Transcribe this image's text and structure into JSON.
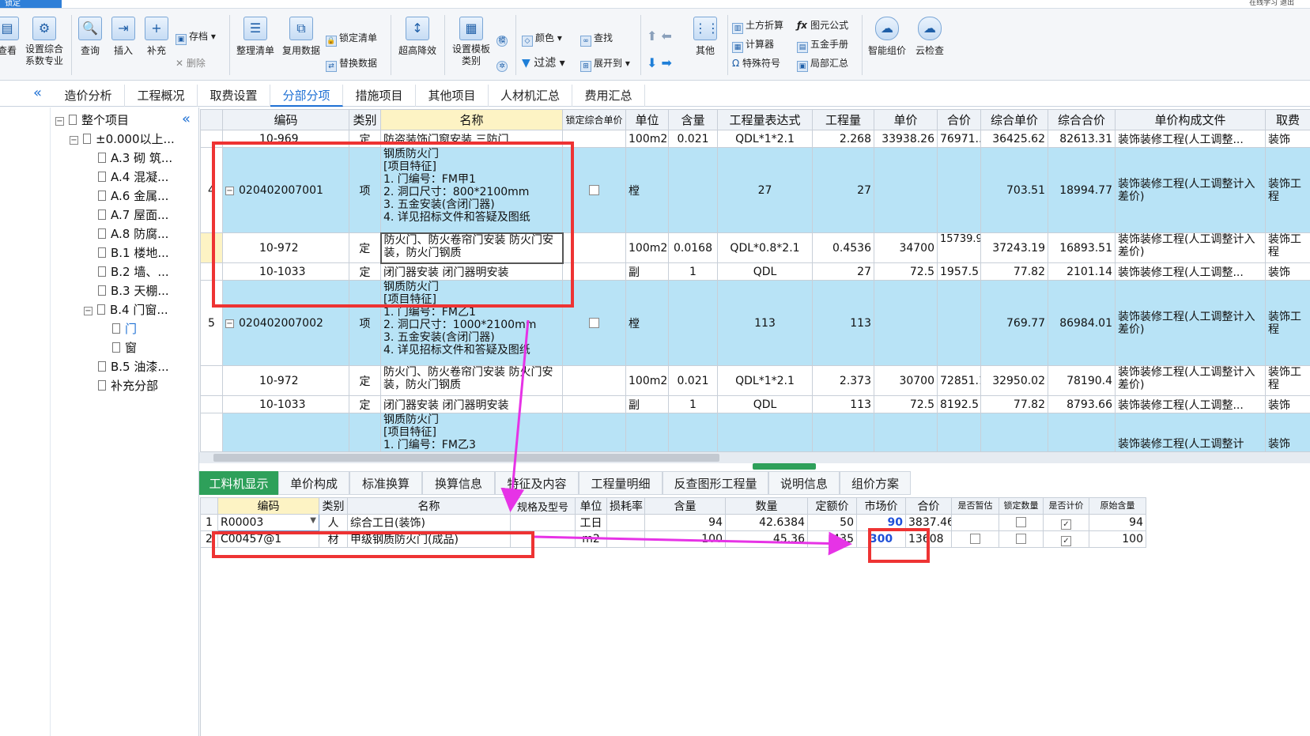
{
  "title_tab": "锁定",
  "title_right": "在线学习  退出",
  "ribbon": {
    "buttons": [
      {
        "label": "查看",
        "icon": "view-icon"
      },
      {
        "label": "设置综合系数专业",
        "icon": "settings-icon"
      },
      {
        "label": "查询",
        "icon": "query-icon"
      },
      {
        "label": "插入",
        "icon": "insert-icon"
      },
      {
        "label": "补充",
        "icon": "supplement-icon"
      },
      {
        "label": "整理清单",
        "icon": "organize-icon"
      },
      {
        "label": "复用数据",
        "icon": "reuse-icon"
      },
      {
        "label": "超高降效",
        "icon": "height-icon"
      },
      {
        "label": "设置模板类别",
        "icon": "template-icon"
      },
      {
        "label": "其他",
        "icon": "other-icon"
      },
      {
        "label": "智能组价",
        "icon": "cloud-price-icon"
      },
      {
        "label": "云检查",
        "icon": "cloud-check-icon"
      }
    ],
    "small": {
      "save": "存档",
      "delete": "删除",
      "lock": "锁定清单",
      "replace": "替换数据",
      "color": "颜色",
      "find": "查找",
      "filter": "过滤",
      "expand": "展开到",
      "earth": "土方折算",
      "formula": "图元公式",
      "calc": "计算器",
      "hardware": "五金手册",
      "special": "特殊符号",
      "local": "局部汇总"
    }
  },
  "tabs": [
    "造价分析",
    "工程概况",
    "取费设置",
    "分部分项",
    "措施项目",
    "其他项目",
    "人材机汇总",
    "费用汇总"
  ],
  "tree": {
    "root": "整个项目",
    "level1": "±0.000以上...",
    "items": [
      "A.3 砌 筑...",
      "A.4 混凝...",
      "A.6 金属...",
      "A.7 屋面...",
      "A.8 防腐...",
      "B.1 楼地...",
      "B.2 墙、...",
      "B.3 天棚...",
      "B.4 门窗...",
      "门",
      "窗",
      "B.5 油漆...",
      "补充分部"
    ]
  },
  "grid": {
    "headers": [
      "编码",
      "类别",
      "名称",
      "锁定综合单价",
      "单位",
      "含量",
      "工程量表达式",
      "工程量",
      "单价",
      "合价",
      "综合单价",
      "综合合价",
      "单价构成文件",
      "取费"
    ],
    "row0": {
      "code": "10-969",
      "type": "定",
      "name": "防盗装饰门窗安装 三防门",
      "unit": "100m2",
      "qty": "0.021",
      "expr": "QDL*1*2.1",
      "amount": "2.268",
      "price": "33938.26",
      "total": "76971...",
      "cprice": "36425.62",
      "ctotal": "82613.31",
      "file": "装饰装修工程(人工调整...",
      "fee": "装饰"
    },
    "row4": {
      "no": "4",
      "code": "020402007001",
      "type": "项",
      "name_lines": [
        "钢质防火门",
        "[项目特征]",
        "1. 门编号：FM甲1",
        "2. 洞口尺寸：800*2100mm",
        "3. 五金安装(含闭门器)",
        "4. 详见招标文件和答疑及图纸"
      ],
      "unit": "樘",
      "expr": "27",
      "amount": "27",
      "cprice": "703.51",
      "ctotal": "18994.77",
      "file": "装饰装修工程(人工调整计入差价)",
      "fee": "装饰工程"
    },
    "row4a": {
      "code": "10-972",
      "type": "定",
      "name": "防火门、防火卷帘门安装 防火门安装，防火门钢质",
      "unit": "100m2",
      "qty": "0.0168",
      "expr": "QDL*0.8*2.1",
      "amount": "0.4536",
      "price": "34700",
      "total": "15739.92",
      "cprice": "37243.19",
      "ctotal": "16893.51",
      "file": "装饰装修工程(人工调整计入差价)",
      "fee": "装饰工程"
    },
    "row4b": {
      "code": "10-1033",
      "type": "定",
      "name": "闭门器安装 闭门器明安装",
      "unit": "副",
      "qty": "1",
      "expr": "QDL",
      "amount": "27",
      "price": "72.5",
      "total": "1957.5",
      "cprice": "77.82",
      "ctotal": "2101.14",
      "file": "装饰装修工程(人工调整...",
      "fee": "装饰"
    },
    "row5": {
      "no": "5",
      "code": "020402007002",
      "type": "项",
      "name_lines": [
        "钢质防火门",
        "[项目特征]",
        "1. 门编号：FM乙1",
        "2. 洞口尺寸：1000*2100mm",
        "3. 五金安装(含闭门器)",
        "4. 详见招标文件和答疑及图纸"
      ],
      "unit": "樘",
      "expr": "113",
      "amount": "113",
      "cprice": "769.77",
      "ctotal": "86984.01",
      "file": "装饰装修工程(人工调整计入差价)",
      "fee": "装饰工程"
    },
    "row5a": {
      "code": "10-972",
      "type": "定",
      "name": "防火门、防火卷帘门安装 防火门安装，防火门钢质",
      "unit": "100m2",
      "qty": "0.021",
      "expr": "QDL*1*2.1",
      "amount": "2.373",
      "price": "30700",
      "total": "72851.1",
      "cprice": "32950.02",
      "ctotal": "78190.4",
      "file": "装饰装修工程(人工调整计入差价)",
      "fee": "装饰工程"
    },
    "row5b": {
      "code": "10-1033",
      "type": "定",
      "name": "闭门器安装 闭门器明安装",
      "unit": "副",
      "qty": "1",
      "expr": "QDL",
      "amount": "113",
      "price": "72.5",
      "total": "8192.5",
      "cprice": "77.82",
      "ctotal": "8793.66",
      "file": "装饰装修工程(人工调整...",
      "fee": "装饰"
    },
    "row6": {
      "name_lines": [
        "钢质防火门",
        "[项目特征]",
        "1. 门编号：FM乙3"
      ],
      "file": "装饰装修工程(人工调整计",
      "fee": "装饰"
    }
  },
  "subtabs": [
    "工料机显示",
    "单价构成",
    "标准换算",
    "换算信息",
    "特征及内容",
    "工程量明细",
    "反查图形工程量",
    "说明信息",
    "组价方案"
  ],
  "subgrid": {
    "headers": [
      "编码",
      "类别",
      "名称",
      "规格及型号",
      "单位",
      "损耗率",
      "含量",
      "数量",
      "定额价",
      "市场价",
      "合价",
      "是否暂估",
      "锁定数量",
      "是否计价",
      "原始含量"
    ],
    "rows": [
      {
        "no": "1",
        "code": "R00003",
        "type": "人",
        "name": "综合工日(装饰)",
        "unit": "工日",
        "qty": "94",
        "num": "42.6384",
        "base": "50",
        "market": "90",
        "total": "3837.46",
        "orig": "94"
      },
      {
        "no": "2",
        "code": "C00457@1",
        "type": "材",
        "name": "甲级钢质防火门(成品)",
        "unit": "m2",
        "qty": "100",
        "num": "45.36",
        "base": "435",
        "market": "300",
        "total": "13608",
        "orig": "100"
      }
    ]
  },
  "colors": {
    "accent": "#1e70d4",
    "row_blue": "#b8e3f6",
    "subtab_active": "#2ea05a",
    "annot_red": "#ee3333",
    "annot_magenta": "#e633e6"
  }
}
